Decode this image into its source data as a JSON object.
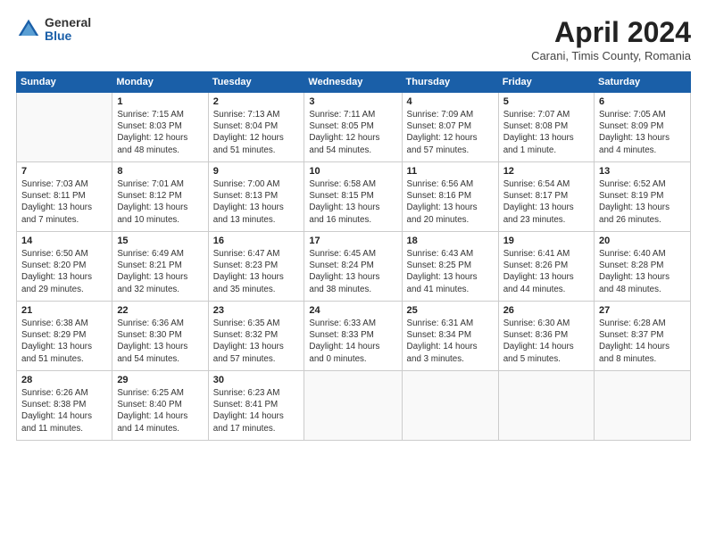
{
  "header": {
    "logo_general": "General",
    "logo_blue": "Blue",
    "title": "April 2024",
    "subtitle": "Carani, Timis County, Romania"
  },
  "calendar": {
    "days": [
      "Sunday",
      "Monday",
      "Tuesday",
      "Wednesday",
      "Thursday",
      "Friday",
      "Saturday"
    ],
    "weeks": [
      [
        {
          "num": "",
          "info": ""
        },
        {
          "num": "1",
          "info": "Sunrise: 7:15 AM\nSunset: 8:03 PM\nDaylight: 12 hours\nand 48 minutes."
        },
        {
          "num": "2",
          "info": "Sunrise: 7:13 AM\nSunset: 8:04 PM\nDaylight: 12 hours\nand 51 minutes."
        },
        {
          "num": "3",
          "info": "Sunrise: 7:11 AM\nSunset: 8:05 PM\nDaylight: 12 hours\nand 54 minutes."
        },
        {
          "num": "4",
          "info": "Sunrise: 7:09 AM\nSunset: 8:07 PM\nDaylight: 12 hours\nand 57 minutes."
        },
        {
          "num": "5",
          "info": "Sunrise: 7:07 AM\nSunset: 8:08 PM\nDaylight: 13 hours\nand 1 minute."
        },
        {
          "num": "6",
          "info": "Sunrise: 7:05 AM\nSunset: 8:09 PM\nDaylight: 13 hours\nand 4 minutes."
        }
      ],
      [
        {
          "num": "7",
          "info": "Sunrise: 7:03 AM\nSunset: 8:11 PM\nDaylight: 13 hours\nand 7 minutes."
        },
        {
          "num": "8",
          "info": "Sunrise: 7:01 AM\nSunset: 8:12 PM\nDaylight: 13 hours\nand 10 minutes."
        },
        {
          "num": "9",
          "info": "Sunrise: 7:00 AM\nSunset: 8:13 PM\nDaylight: 13 hours\nand 13 minutes."
        },
        {
          "num": "10",
          "info": "Sunrise: 6:58 AM\nSunset: 8:15 PM\nDaylight: 13 hours\nand 16 minutes."
        },
        {
          "num": "11",
          "info": "Sunrise: 6:56 AM\nSunset: 8:16 PM\nDaylight: 13 hours\nand 20 minutes."
        },
        {
          "num": "12",
          "info": "Sunrise: 6:54 AM\nSunset: 8:17 PM\nDaylight: 13 hours\nand 23 minutes."
        },
        {
          "num": "13",
          "info": "Sunrise: 6:52 AM\nSunset: 8:19 PM\nDaylight: 13 hours\nand 26 minutes."
        }
      ],
      [
        {
          "num": "14",
          "info": "Sunrise: 6:50 AM\nSunset: 8:20 PM\nDaylight: 13 hours\nand 29 minutes."
        },
        {
          "num": "15",
          "info": "Sunrise: 6:49 AM\nSunset: 8:21 PM\nDaylight: 13 hours\nand 32 minutes."
        },
        {
          "num": "16",
          "info": "Sunrise: 6:47 AM\nSunset: 8:23 PM\nDaylight: 13 hours\nand 35 minutes."
        },
        {
          "num": "17",
          "info": "Sunrise: 6:45 AM\nSunset: 8:24 PM\nDaylight: 13 hours\nand 38 minutes."
        },
        {
          "num": "18",
          "info": "Sunrise: 6:43 AM\nSunset: 8:25 PM\nDaylight: 13 hours\nand 41 minutes."
        },
        {
          "num": "19",
          "info": "Sunrise: 6:41 AM\nSunset: 8:26 PM\nDaylight: 13 hours\nand 44 minutes."
        },
        {
          "num": "20",
          "info": "Sunrise: 6:40 AM\nSunset: 8:28 PM\nDaylight: 13 hours\nand 48 minutes."
        }
      ],
      [
        {
          "num": "21",
          "info": "Sunrise: 6:38 AM\nSunset: 8:29 PM\nDaylight: 13 hours\nand 51 minutes."
        },
        {
          "num": "22",
          "info": "Sunrise: 6:36 AM\nSunset: 8:30 PM\nDaylight: 13 hours\nand 54 minutes."
        },
        {
          "num": "23",
          "info": "Sunrise: 6:35 AM\nSunset: 8:32 PM\nDaylight: 13 hours\nand 57 minutes."
        },
        {
          "num": "24",
          "info": "Sunrise: 6:33 AM\nSunset: 8:33 PM\nDaylight: 14 hours\nand 0 minutes."
        },
        {
          "num": "25",
          "info": "Sunrise: 6:31 AM\nSunset: 8:34 PM\nDaylight: 14 hours\nand 3 minutes."
        },
        {
          "num": "26",
          "info": "Sunrise: 6:30 AM\nSunset: 8:36 PM\nDaylight: 14 hours\nand 5 minutes."
        },
        {
          "num": "27",
          "info": "Sunrise: 6:28 AM\nSunset: 8:37 PM\nDaylight: 14 hours\nand 8 minutes."
        }
      ],
      [
        {
          "num": "28",
          "info": "Sunrise: 6:26 AM\nSunset: 8:38 PM\nDaylight: 14 hours\nand 11 minutes."
        },
        {
          "num": "29",
          "info": "Sunrise: 6:25 AM\nSunset: 8:40 PM\nDaylight: 14 hours\nand 14 minutes."
        },
        {
          "num": "30",
          "info": "Sunrise: 6:23 AM\nSunset: 8:41 PM\nDaylight: 14 hours\nand 17 minutes."
        },
        {
          "num": "",
          "info": ""
        },
        {
          "num": "",
          "info": ""
        },
        {
          "num": "",
          "info": ""
        },
        {
          "num": "",
          "info": ""
        }
      ]
    ]
  }
}
